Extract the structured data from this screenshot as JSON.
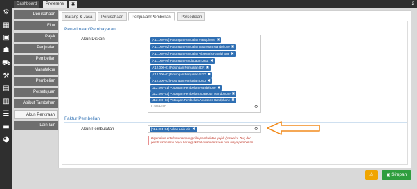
{
  "window": {
    "tabs": [
      {
        "label": "Dashboard"
      },
      {
        "label": "Preferensi"
      }
    ],
    "close_symbol": "✖",
    "top_right_text": "2"
  },
  "icons": [
    "gear-icon",
    "building-icon",
    "box-icon",
    "user-icon",
    "cart-icon",
    "wrench-icon",
    "money-icon",
    "document-icon",
    "list-icon",
    "printer-icon",
    "chart-icon"
  ],
  "menu": {
    "items": [
      {
        "label": "Perusahaan"
      },
      {
        "label": "Fitur"
      },
      {
        "label": "Pajak"
      },
      {
        "label": "Penjualan"
      },
      {
        "label": "Pembelian"
      },
      {
        "label": "Manufaktur"
      },
      {
        "label": "Pembelian"
      },
      {
        "label": "Persetujuan"
      },
      {
        "label": "Atribut Tambahan"
      },
      {
        "label": "Akun Perkiraan"
      },
      {
        "label": "Lain-lain"
      }
    ],
    "active_index": 9
  },
  "subtabs": [
    {
      "label": "Barang & Jasa"
    },
    {
      "label": "Perusahaan"
    },
    {
      "label": "Penjualan/Pembelian"
    },
    {
      "label": "Persediaan"
    }
  ],
  "section1": {
    "title": "Penerimaan/Pembayaran",
    "field_label": "Akun Diskon",
    "tags": [
      "[A11.000-01] Potongan Penjualan Handphone",
      "[A11.000-02] Potongan Penjualan Sparepart Handphone",
      "[A11.000-03] Potongan Penjualan Aksesoris Handphone",
      "[A11.000-99] Potongan Pendapatan Jasa",
      "[A12.000-01] Potongan Penjualan IDR",
      "[A12.000-02] Potongan Penjualan SGD",
      "[A12.000-03] Potongan Penjualan USD",
      "[J12.000-01] Potongan Pembelian Handphone",
      "[J12.000-02] Potongan Pembelian Sparepart Handphone",
      "[J12.000-03] Potongan Pembelian Aksesoris Handphone"
    ],
    "placeholder": "Cari/Pilih..."
  },
  "section2": {
    "title": "Faktur Pembelian",
    "field_label": "Akun Pembulatan",
    "selected_tag": "[A12.001-04] Akkan Lain lain",
    "hint": "Digunakan untuk menampung nilai pembulatan pajak (Inclusive Tax) dan pembulatan nilai biaya barang akibat diskon/ekskesi nilai biaya pembelian"
  },
  "buttons": {
    "warning_symbol": "⚠",
    "save_label": "Simpan"
  },
  "colors": {
    "tag_bg": "#2f6fb3",
    "section_title": "#3a78b8",
    "save_button": "#2e9e3e",
    "warning_button": "#f0a500",
    "arrow": "#f28c1e"
  }
}
